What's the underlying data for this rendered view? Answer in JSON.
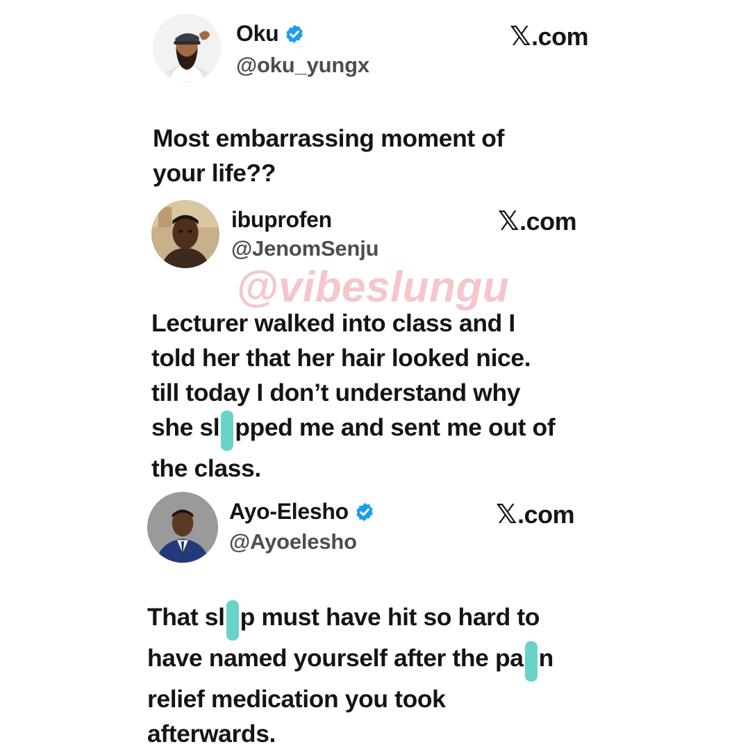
{
  "tweets": [
    {
      "name": "Oku",
      "verified": true,
      "handle": "@oku_yungx",
      "site_mark": "𝕏",
      "site_suffix": ".com",
      "body_lines": [
        "Most embarrassing moment of",
        "your life??"
      ]
    },
    {
      "name": "ibuprofen",
      "verified": false,
      "handle": "@JenomSenju",
      "site_mark": "𝕏",
      "site_suffix": ".com",
      "body_lines": [
        "Lecturer walked into class and I",
        "told her that her hair looked nice.",
        "till today I don’t understand why",
        {
          "pre": "she sl",
          "post": "pped me and sent me out of"
        },
        "the class."
      ]
    },
    {
      "name": "Ayo-Elesho",
      "verified": true,
      "handle": "@Ayoelesho",
      "site_mark": "𝕏",
      "site_suffix": ".com",
      "body_lines": [
        {
          "pre": "That sl",
          "post": "p must have hit so hard to"
        },
        {
          "pre": "have named yourself after the pa",
          "post": "n"
        },
        "relief medication you took",
        "afterwards."
      ]
    }
  ],
  "watermark": "@vibeslungu",
  "colors": {
    "verified_badge": "#1d9bf0",
    "censor_mark": "#68d3c6",
    "watermark": "#ec9aa0",
    "handle": "#4a4d52"
  },
  "icons": {
    "verified": "verified-badge-icon",
    "censor": "censor-mark"
  }
}
